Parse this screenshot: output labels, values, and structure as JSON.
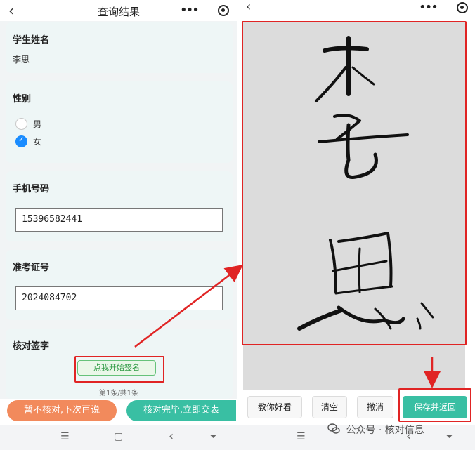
{
  "left": {
    "title": "查询结果",
    "back_icon": "‹",
    "more_icon": "•••",
    "sections": {
      "name": {
        "label": "学生姓名",
        "value": "李思"
      },
      "gender": {
        "label": "性别",
        "options": [
          {
            "label": "男",
            "checked": false
          },
          {
            "label": "女",
            "checked": true
          }
        ]
      },
      "phone": {
        "label": "手机号码",
        "value": "15396582441"
      },
      "exam": {
        "label": "准考证号",
        "value": "2024084702"
      },
      "signature": {
        "label": "核对签字",
        "button": "点我开始签名"
      }
    },
    "pager": "第1条/共1条",
    "actions": {
      "defer": "暂不核对,下次再说",
      "submit": "核对完毕,立即交表"
    },
    "sysnav": {
      "menu": "☰",
      "home": "▢",
      "back": "‹",
      "down": "⏷"
    }
  },
  "right": {
    "back_icon": "‹",
    "more_icon": "•••",
    "toolbar": {
      "teach": "教你好看",
      "clear": "清空",
      "undo": "撤消",
      "save": "保存并返回"
    },
    "sysnav": {
      "menu": "☰",
      "back": "‹",
      "down": "⏷"
    },
    "watermark": "公众号 · 核对信息"
  },
  "colors": {
    "accent_green": "#39bfa3",
    "accent_orange": "#f28a5c",
    "annotation_red": "#e02424",
    "radio_blue": "#1a8cff"
  }
}
